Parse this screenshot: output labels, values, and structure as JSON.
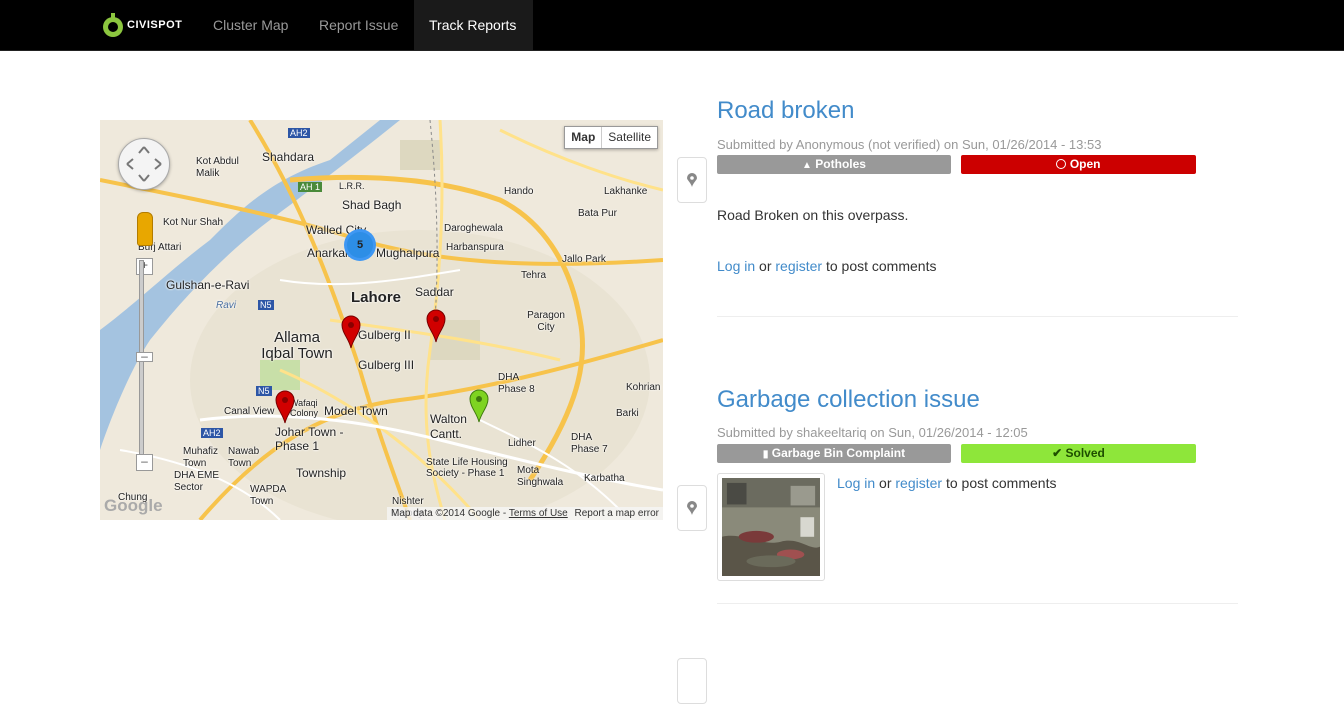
{
  "nav": {
    "brand": "CIVISPOT",
    "items": [
      {
        "label": "Cluster Map"
      },
      {
        "label": "Report Issue"
      },
      {
        "label": "Track Reports"
      }
    ]
  },
  "map": {
    "type_buttons": [
      "Map",
      "Satellite"
    ],
    "labels": [
      "Shahdara",
      "Kot Abdul Malik",
      "Shad Bagh",
      "Walled City",
      "Mughalpura",
      "Daroghewala",
      "Harbanspura",
      "Hando",
      "Lakhanke",
      "Bata Pur",
      "Kot Nur Shah",
      "Burj Attari",
      "Anarkali",
      "Lahore",
      "Gulshan-e-Ravi",
      "Saddar",
      "Allama Iqbal Town",
      "Gulberg II",
      "Gulberg III",
      "Paragon City",
      "Jallo Park",
      "Tehra",
      "DHA Phase 8",
      "Kohrian",
      "Canal View",
      "Wafaqi Colony",
      "Model Town",
      "Johar Town - Phase 1",
      "Walton Cantt.",
      "Barki",
      "Lidher",
      "DHA Phase 7",
      "Muhafiz Town",
      "Nawab Town",
      "DHA EME Sector",
      "Township",
      "State Life Housing Society - Phase 1",
      "Mota Singhwala",
      "Karbatha",
      "WAPDA Town",
      "Chung",
      "Nishter Colony",
      "Ravi",
      "L.R.R.",
      "AH 1",
      "AH2",
      "N5",
      "AH2",
      "N5"
    ],
    "cluster_count": "5",
    "attribution": "Map data ©2014 Google",
    "terms": "Terms of Use",
    "report_error": "Report a map error",
    "google": "Google"
  },
  "reports": [
    {
      "title": "Road broken",
      "meta": "Submitted by Anonymous (not verified) on Sun, 01/26/2014 - 13:53",
      "category": "Potholes",
      "status": "Open",
      "status_color": "#cc0000",
      "body": "Road Broken on this overpass.",
      "login": "Log in",
      "or": "or",
      "register": "register",
      "post": "to post comments"
    },
    {
      "title": "Garbage collection issue",
      "meta": "Submitted by shakeeltariq on Sun, 01/26/2014 - 12:05",
      "category": "Garbage Bin Complaint",
      "status": "Solved",
      "status_color": "#8ee63a",
      "login": "Log in",
      "or": "or",
      "register": "register",
      "post": "to post comments"
    }
  ]
}
